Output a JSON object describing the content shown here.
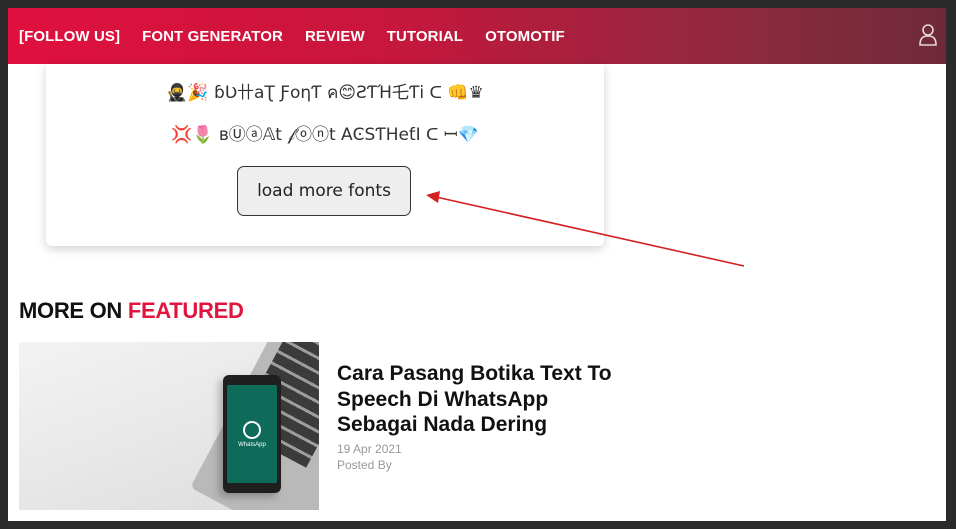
{
  "nav": {
    "items": [
      "[FOLLOW US]",
      "FONT GENERATOR",
      "REVIEW",
      "TUTORIAL",
      "OTOMOTIF"
    ],
    "user_icon": "user-icon",
    "gradient_colors": [
      "#e0103e",
      "#6e2a3a"
    ]
  },
  "fonts_card": {
    "lines": [
      "🥷🎉 ɓƲ卄aƮ ƑoηƬ ค😊ƧƬΉ乇Ƭi ᑕ 👊♛",
      "💢🌷 ʙⓊⓐ𝔸t 𝒻ⓞⓝt ΑϾЅƬΗeƭΙ ᑕ ꟷ💎"
    ],
    "load_more_label": "load more fonts"
  },
  "more_section": {
    "title_prefix": "MORE ON",
    "title_accent": "FEATURED",
    "accent_color": "#e0163f",
    "post": {
      "title": "Cara Pasang Botika Text To Speech Di WhatsApp Sebagai Nada Dering",
      "date": "19 Apr 2021",
      "posted_by": "Posted By",
      "thumb_text": "WhatsApp"
    }
  },
  "annotation": {
    "arrow_color": "#d42020"
  }
}
